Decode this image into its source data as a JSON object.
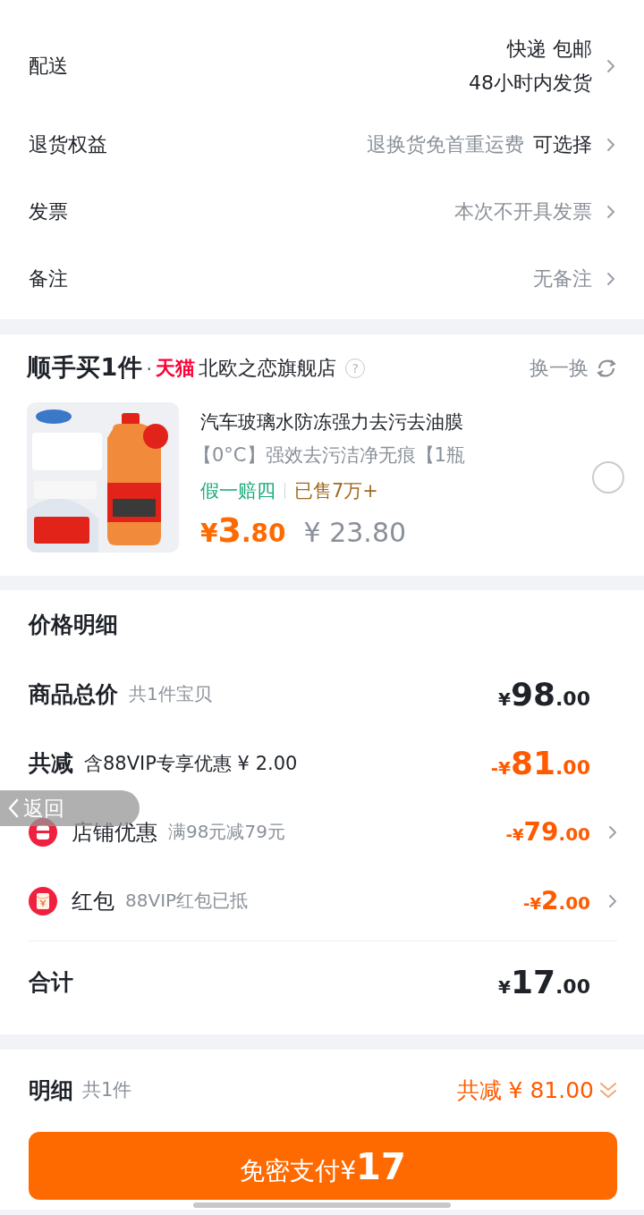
{
  "order_rows": [
    {
      "kind": "multi",
      "label": "配送",
      "lines": [
        "快递 包邮",
        "48小时内发货"
      ]
    },
    {
      "kind": "option",
      "label": "退货权益",
      "hint": "退换货免首重运费",
      "value": "可选择"
    },
    {
      "kind": "plain",
      "label": "发票",
      "hint": "本次不开具发票"
    },
    {
      "kind": "plain",
      "label": "备注",
      "hint": "无备注"
    }
  ],
  "addon": {
    "title": "顺手买1件",
    "separator": "·",
    "platform": "天猫",
    "store": "北欧之恋旗舰店",
    "help": "?",
    "swap": "换一换",
    "product": {
      "kind": "picture",
      "name_lines": [
        "汽车玻璃水防冻强力去污去油膜",
        "【0°C】强效去污洁净无痕【1瓶"
      ],
      "guarantee": "假一赔四",
      "sold": "已售7万+",
      "currency": "¥",
      "price_main": "3",
      "price_decimals": ".80",
      "original_price": "¥ 23.80",
      "selected": false
    }
  },
  "price_detail": {
    "title": "价格明细",
    "rows": [
      {
        "kind": "subtotal",
        "label": "商品总价",
        "note": "共1件宝贝",
        "amount": {
          "prefix": "¥",
          "main": "98",
          "decimals": ".00"
        }
      },
      {
        "kind": "discount",
        "label": "共减",
        "note": "含88VIP专享优惠 ¥ 2.00",
        "amount": {
          "prefix": "-¥",
          "main": "81",
          "decimals": ".00"
        }
      },
      {
        "kind": "store_coupon",
        "label": "店铺优惠",
        "note": "满98元减79元",
        "amount": {
          "prefix": "-¥",
          "main": "79",
          "decimals": ".00"
        }
      },
      {
        "kind": "red_packet",
        "label": "红包",
        "note": "88VIP红包已抵",
        "amount": {
          "prefix": "-¥",
          "main": "2",
          "decimals": ".00"
        }
      }
    ],
    "total": {
      "label": "合计",
      "amount": {
        "prefix": "¥",
        "main": "17",
        "decimals": ".00"
      }
    }
  },
  "footer": {
    "label": "明细",
    "note": "共1件",
    "saving": "共减 ¥ 81.00",
    "pay_prefix": "免密支付¥",
    "pay_amount": "17"
  },
  "back_button": {
    "label": "返回"
  }
}
